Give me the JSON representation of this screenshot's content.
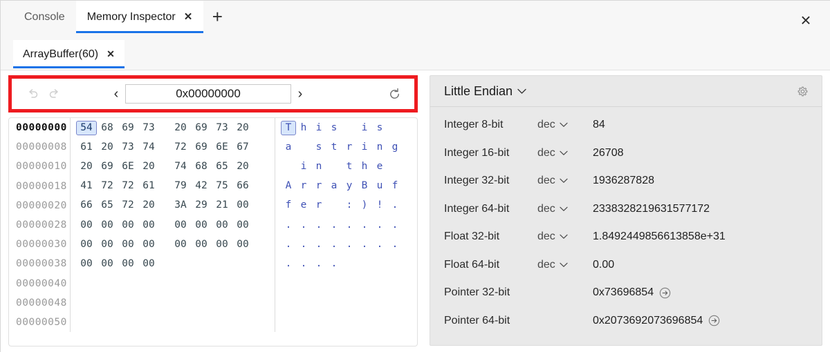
{
  "window": {
    "close_label": "×"
  },
  "tabs": {
    "items": [
      {
        "label": "Console",
        "active": false,
        "closable": false
      },
      {
        "label": "Memory Inspector",
        "active": true,
        "closable": true
      }
    ],
    "new_tab_label": "+",
    "close_label": "✕"
  },
  "subtabs": {
    "items": [
      {
        "label": "ArrayBuffer(60)",
        "active": true,
        "closable": true
      }
    ],
    "close_label": "✕"
  },
  "toolbar": {
    "undo_label": "undo-icon",
    "redo_label": "redo-icon",
    "prev_label": "‹",
    "next_label": "›",
    "address_value": "0x00000000",
    "address_placeholder": "0x00000000",
    "refresh_label": "refresh-icon"
  },
  "hex": {
    "rows": [
      {
        "address": "00000000",
        "current": true,
        "bytes": [
          "54",
          "68",
          "69",
          "73",
          "20",
          "69",
          "73",
          "20"
        ],
        "ascii": [
          "T",
          "h",
          "i",
          "s",
          " ",
          "i",
          "s",
          " "
        ]
      },
      {
        "address": "00000008",
        "current": false,
        "bytes": [
          "61",
          "20",
          "73",
          "74",
          "72",
          "69",
          "6E",
          "67"
        ],
        "ascii": [
          "a",
          " ",
          "s",
          "t",
          "r",
          "i",
          "n",
          "g"
        ]
      },
      {
        "address": "00000010",
        "current": false,
        "bytes": [
          "20",
          "69",
          "6E",
          "20",
          "74",
          "68",
          "65",
          "20"
        ],
        "ascii": [
          " ",
          "i",
          "n",
          " ",
          "t",
          "h",
          "e",
          " "
        ]
      },
      {
        "address": "00000018",
        "current": false,
        "bytes": [
          "41",
          "72",
          "72",
          "61",
          "79",
          "42",
          "75",
          "66"
        ],
        "ascii": [
          "A",
          "r",
          "r",
          "a",
          "y",
          "B",
          "u",
          "f"
        ]
      },
      {
        "address": "00000020",
        "current": false,
        "bytes": [
          "66",
          "65",
          "72",
          "20",
          "3A",
          "29",
          "21",
          "00"
        ],
        "ascii": [
          "f",
          "e",
          "r",
          " ",
          ":",
          ")",
          "!",
          "."
        ]
      },
      {
        "address": "00000028",
        "current": false,
        "bytes": [
          "00",
          "00",
          "00",
          "00",
          "00",
          "00",
          "00",
          "00"
        ],
        "ascii": [
          ".",
          ".",
          ".",
          ".",
          ".",
          ".",
          ".",
          "."
        ]
      },
      {
        "address": "00000030",
        "current": false,
        "bytes": [
          "00",
          "00",
          "00",
          "00",
          "00",
          "00",
          "00",
          "00"
        ],
        "ascii": [
          ".",
          ".",
          ".",
          ".",
          ".",
          ".",
          ".",
          "."
        ]
      },
      {
        "address": "00000038",
        "current": false,
        "bytes": [
          "00",
          "00",
          "00",
          "00"
        ],
        "ascii": [
          ".",
          ".",
          ".",
          "."
        ]
      },
      {
        "address": "00000040",
        "current": false,
        "bytes": [],
        "ascii": []
      },
      {
        "address": "00000048",
        "current": false,
        "bytes": [],
        "ascii": []
      },
      {
        "address": "00000050",
        "current": false,
        "bytes": [],
        "ascii": []
      }
    ],
    "selected_index": 0
  },
  "value_panel": {
    "endianness": "Little Endian",
    "endian_chevron": "⌄",
    "settings_label": "settings-gear",
    "rows": [
      {
        "label": "Integer 8-bit",
        "mode": "dec",
        "value": "84",
        "has_mode": true,
        "has_jump": false
      },
      {
        "label": "Integer 16-bit",
        "mode": "dec",
        "value": "26708",
        "has_mode": true,
        "has_jump": false
      },
      {
        "label": "Integer 32-bit",
        "mode": "dec",
        "value": "1936287828",
        "has_mode": true,
        "has_jump": false
      },
      {
        "label": "Integer 64-bit",
        "mode": "dec",
        "value": "2338328219631577172",
        "has_mode": true,
        "has_jump": false
      },
      {
        "label": "Float 32-bit",
        "mode": "dec",
        "value": "1.8492449856613858e+31",
        "has_mode": true,
        "has_jump": false
      },
      {
        "label": "Float 64-bit",
        "mode": "dec",
        "value": "0.00",
        "has_mode": true,
        "has_jump": false
      },
      {
        "label": "Pointer 32-bit",
        "mode": "",
        "value": "0x73696854",
        "has_mode": false,
        "has_jump": true
      },
      {
        "label": "Pointer 64-bit",
        "mode": "",
        "value": "0x2073692073696854",
        "has_mode": false,
        "has_jump": true
      }
    ]
  },
  "colors": {
    "accent": "#1a73e8",
    "highlight_box": "#ee1b20",
    "selection_bg": "#d7e6fb",
    "selection_border": "#7986cb",
    "ascii_text": "#3f51b5",
    "panel_bg": "#e9e9e9"
  }
}
